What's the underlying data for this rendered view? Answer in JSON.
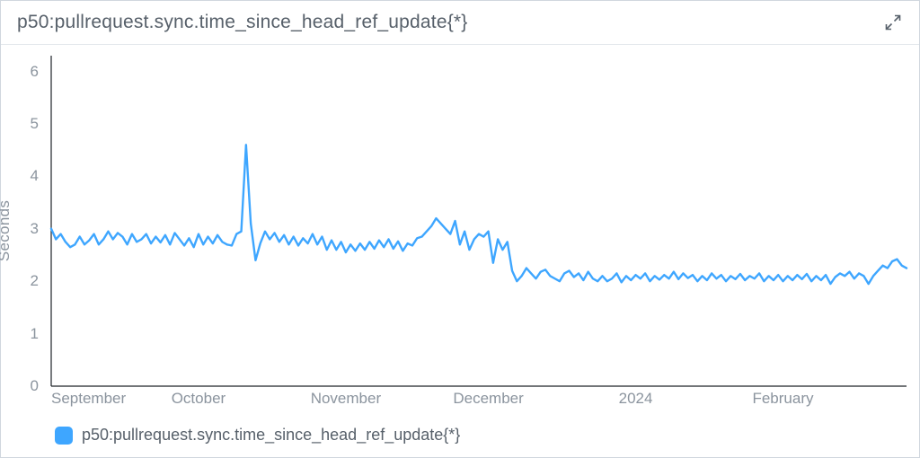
{
  "header": {
    "title": "p50:pullrequest.sync.time_since_head_ref_update{*}",
    "expand_icon": "expand-icon"
  },
  "chart_data": {
    "type": "line",
    "title": "p50:pullrequest.sync.time_since_head_ref_update{*}",
    "ylabel": "Seconds",
    "xlabel": "",
    "ylim": [
      0,
      6.3
    ],
    "y_ticks": [
      0,
      1,
      2,
      3,
      4,
      5,
      6
    ],
    "x_tick_labels": [
      "September",
      "October",
      "November",
      "December",
      "2024",
      "February"
    ],
    "x_tick_positions": [
      0,
      31,
      62,
      92,
      123,
      154
    ],
    "x_range": [
      0,
      180
    ],
    "series": [
      {
        "name": "p50:pullrequest.sync.time_since_head_ref_update{*}",
        "color": "#3ea6ff",
        "x": [
          0,
          1,
          2,
          3,
          4,
          5,
          6,
          7,
          8,
          9,
          10,
          11,
          12,
          13,
          14,
          15,
          16,
          17,
          18,
          19,
          20,
          21,
          22,
          23,
          24,
          25,
          26,
          27,
          28,
          29,
          30,
          31,
          32,
          33,
          34,
          35,
          36,
          37,
          38,
          39,
          40,
          41,
          42,
          43,
          44,
          45,
          46,
          47,
          48,
          49,
          50,
          51,
          52,
          53,
          54,
          55,
          56,
          57,
          58,
          59,
          60,
          61,
          62,
          63,
          64,
          65,
          66,
          67,
          68,
          69,
          70,
          71,
          72,
          73,
          74,
          75,
          76,
          77,
          78,
          79,
          80,
          81,
          82,
          83,
          84,
          85,
          86,
          87,
          88,
          89,
          90,
          91,
          92,
          93,
          94,
          95,
          96,
          97,
          98,
          99,
          100,
          101,
          102,
          103,
          104,
          105,
          106,
          107,
          108,
          109,
          110,
          111,
          112,
          113,
          114,
          115,
          116,
          117,
          118,
          119,
          120,
          121,
          122,
          123,
          124,
          125,
          126,
          127,
          128,
          129,
          130,
          131,
          132,
          133,
          134,
          135,
          136,
          137,
          138,
          139,
          140,
          141,
          142,
          143,
          144,
          145,
          146,
          147,
          148,
          149,
          150,
          151,
          152,
          153,
          154,
          155,
          156,
          157,
          158,
          159,
          160,
          161,
          162,
          163,
          164,
          165,
          166,
          167,
          168,
          169,
          170,
          171,
          172,
          173,
          174,
          175,
          176,
          177,
          178,
          179,
          180
        ],
        "values": [
          3.0,
          2.8,
          2.9,
          2.75,
          2.65,
          2.7,
          2.85,
          2.7,
          2.78,
          2.9,
          2.7,
          2.8,
          2.95,
          2.8,
          2.92,
          2.85,
          2.7,
          2.9,
          2.75,
          2.8,
          2.9,
          2.72,
          2.85,
          2.74,
          2.88,
          2.7,
          2.92,
          2.8,
          2.68,
          2.82,
          2.65,
          2.9,
          2.7,
          2.85,
          2.72,
          2.88,
          2.75,
          2.7,
          2.68,
          2.9,
          2.95,
          4.6,
          3.1,
          2.4,
          2.72,
          2.95,
          2.8,
          2.92,
          2.75,
          2.88,
          2.7,
          2.85,
          2.68,
          2.82,
          2.72,
          2.9,
          2.7,
          2.85,
          2.6,
          2.78,
          2.6,
          2.75,
          2.55,
          2.7,
          2.58,
          2.72,
          2.6,
          2.75,
          2.62,
          2.78,
          2.65,
          2.8,
          2.62,
          2.76,
          2.58,
          2.72,
          2.68,
          2.82,
          2.85,
          2.95,
          3.05,
          3.2,
          3.1,
          3.0,
          2.9,
          3.15,
          2.7,
          2.95,
          2.6,
          2.8,
          2.9,
          2.85,
          2.95,
          2.35,
          2.8,
          2.6,
          2.75,
          2.2,
          2.0,
          2.1,
          2.25,
          2.15,
          2.05,
          2.18,
          2.22,
          2.1,
          2.05,
          2.0,
          2.15,
          2.2,
          2.08,
          2.15,
          2.02,
          2.18,
          2.05,
          2.0,
          2.1,
          2.0,
          2.05,
          2.15,
          1.98,
          2.1,
          2.02,
          2.12,
          2.05,
          2.15,
          2.0,
          2.1,
          2.03,
          2.12,
          2.05,
          2.18,
          2.04,
          2.15,
          2.06,
          2.12,
          2.0,
          2.1,
          2.02,
          2.15,
          2.05,
          2.12,
          2.0,
          2.1,
          2.04,
          2.14,
          2.02,
          2.1,
          2.05,
          2.15,
          2.0,
          2.1,
          2.02,
          2.12,
          2.0,
          2.1,
          2.02,
          2.12,
          2.04,
          2.14,
          2.0,
          2.1,
          2.02,
          2.12,
          1.95,
          2.08,
          2.15,
          2.1,
          2.18,
          2.05,
          2.15,
          2.1,
          1.95,
          2.1,
          2.2,
          2.3,
          2.25,
          2.38,
          2.42,
          2.3,
          2.25
        ]
      }
    ]
  },
  "legend": {
    "items": [
      {
        "label": "p50:pullrequest.sync.time_since_head_ref_update{*}",
        "color": "#3ea6ff"
      }
    ]
  }
}
